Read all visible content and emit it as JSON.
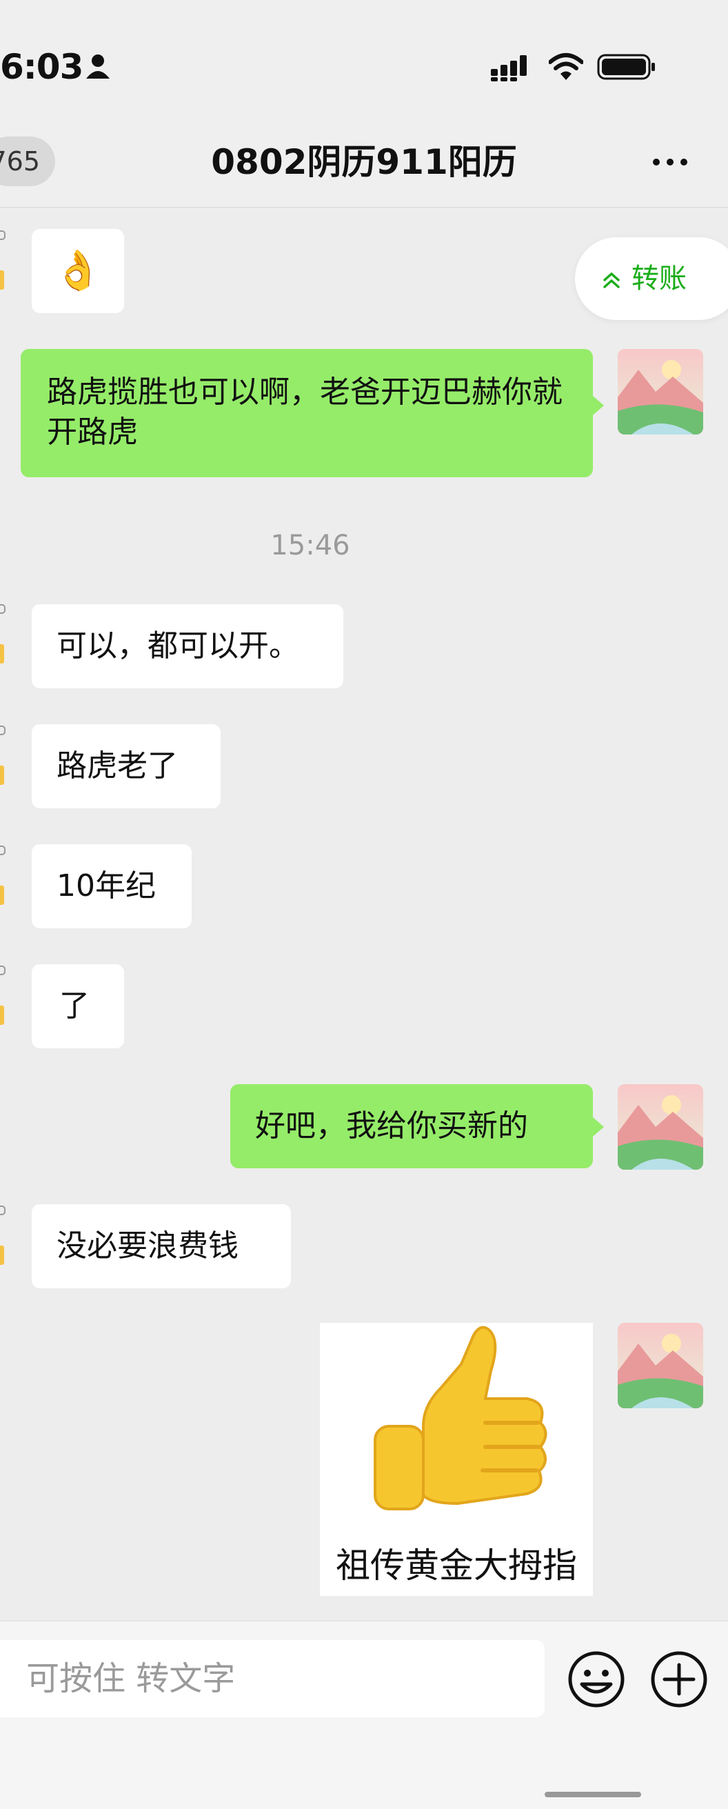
{
  "status": {
    "time": "6:03"
  },
  "nav": {
    "back_count": "765",
    "title": "0802阴历911阳历"
  },
  "transfer": {
    "label": "转账"
  },
  "messages": [
    {
      "side": "left",
      "kind": "emoji",
      "text": "👌"
    },
    {
      "side": "right",
      "text": "路虎揽胜也可以啊，老爸开迈巴赫你就开路虎"
    },
    {
      "side": "left",
      "text": "可以，都可以开。"
    },
    {
      "side": "left",
      "text": "路虎老了"
    },
    {
      "side": "left",
      "text": "10年纪"
    },
    {
      "side": "left",
      "text": "了"
    },
    {
      "side": "right",
      "text": "好吧，我给你买新的"
    },
    {
      "side": "left",
      "text": "没必要浪费钱"
    },
    {
      "side": "right",
      "kind": "sticker",
      "text": "祖传黄金大拇指"
    }
  ],
  "timestamp": "15:46",
  "input": {
    "placeholder": "可按住 转文字"
  },
  "colors": {
    "outgoing": "#95ec69",
    "incoming": "#ffffff",
    "accent": "#1aad19",
    "background": "#ededed"
  },
  "icons": [
    "person-icon",
    "signal-icon",
    "wifi-icon",
    "battery-icon",
    "more-icon",
    "chevron-up-icon",
    "emoji-icon",
    "plus-icon",
    "thumbs-up-sticker"
  ]
}
